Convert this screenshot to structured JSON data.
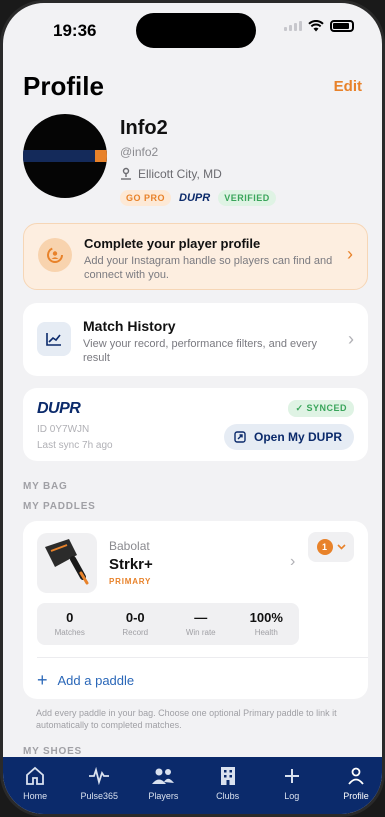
{
  "status": {
    "time": "19:36"
  },
  "header": {
    "title": "Profile",
    "edit_label": "Edit"
  },
  "profile": {
    "name": "Info2",
    "handle": "@info2",
    "location": "Ellicott City, MD",
    "badges": {
      "gopro": "GO PRO",
      "dupr": "DUPR",
      "verified": "VERIFIED"
    }
  },
  "complete_profile": {
    "title": "Complete your player profile",
    "description": "Add your Instagram handle so players can find and connect with you."
  },
  "match_history": {
    "title": "Match History",
    "description": "View your record, performance filters, and every result"
  },
  "dupr": {
    "logo": "DUPR",
    "id": "ID 0Y7WJN",
    "last_sync": "Last sync 7h ago",
    "synced_label": "✓ SYNCED",
    "open_label": "Open My DUPR"
  },
  "sections": {
    "my_bag": "MY BAG",
    "my_paddles": "MY PADDLES",
    "my_shoes": "MY SHOES"
  },
  "paddle": {
    "brand": "Babolat",
    "name": "Strkr+",
    "tag": "PRIMARY",
    "count": "1",
    "stats": [
      {
        "value": "0",
        "label": "Matches"
      },
      {
        "value": "0-0",
        "label": "Record"
      },
      {
        "value": "—",
        "label": "Win rate"
      },
      {
        "value": "100%",
        "label": "Health"
      }
    ],
    "add_label": "Add a paddle"
  },
  "helper_text": "Add every paddle in your bag. Choose one optional Primary paddle to link it automatically to completed matches.",
  "tabs": [
    {
      "label": "Home",
      "icon": "home-icon"
    },
    {
      "label": "Pulse365",
      "icon": "pulse-icon"
    },
    {
      "label": "Players",
      "icon": "players-icon"
    },
    {
      "label": "Clubs",
      "icon": "building-icon"
    },
    {
      "label": "Log",
      "icon": "plus-icon"
    },
    {
      "label": "Profile",
      "icon": "person-icon"
    }
  ],
  "colors": {
    "accent": "#e8822a",
    "navy": "#0b2a6b",
    "green": "#3aa55b",
    "link": "#2a67b8"
  }
}
